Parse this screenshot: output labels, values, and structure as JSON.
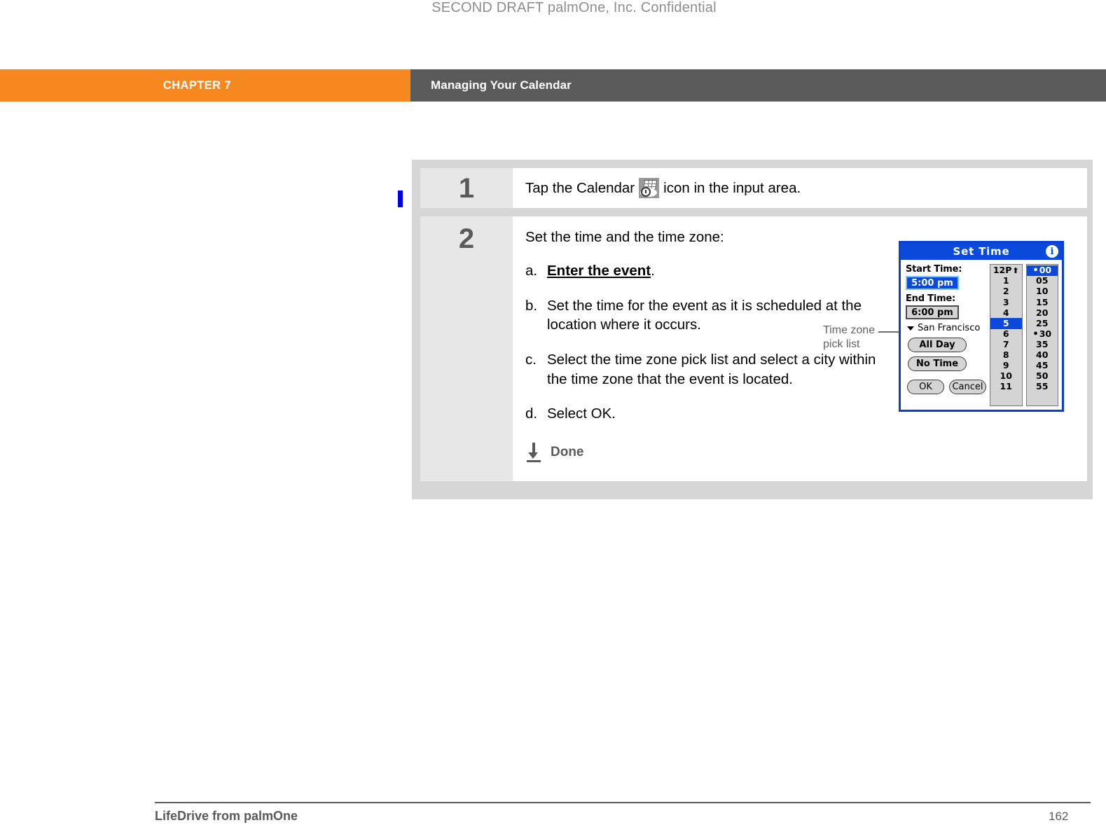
{
  "document": {
    "draft_notice": "SECOND DRAFT palmOne, Inc.  Confidential"
  },
  "header": {
    "chapter_label": "CHAPTER 7",
    "title": "Managing Your Calendar",
    "chapter_bg": "#f6881f",
    "title_bg": "#5a5a5a"
  },
  "steps": [
    {
      "number": "1",
      "text_before_icon": "Tap the Calendar",
      "icon": "calendar-icon",
      "text_after_icon": "icon in the input area."
    },
    {
      "number": "2",
      "lead": "Set the time and the time zone:",
      "substeps": [
        {
          "marker": "a.",
          "text": "Enter the event",
          "emphasis": "bold-underline",
          "suffix": "."
        },
        {
          "marker": "b.",
          "text": "Set the time for the event as it is scheduled at the location where it occurs."
        },
        {
          "marker": "c.",
          "text": "Select the time zone pick list and select a city within the time zone that the event is located."
        },
        {
          "marker": "d.",
          "text": "Select OK."
        }
      ],
      "done_label": "Done",
      "done_icon": "down-arrow-icon"
    }
  ],
  "callout": {
    "line1": "Time zone",
    "line2": "pick list"
  },
  "pda_dialog": {
    "title": "Set Time",
    "info_icon": "info-icon",
    "info_glyph": "i",
    "start_time_label": "Start Time:",
    "start_time_value": "5:00 pm",
    "end_time_label": "End Time:",
    "end_time_value": "6:00 pm",
    "timezone_value": "San Francisco",
    "all_day_label": "All Day",
    "no_time_label": "No Time",
    "ok_label": "OK",
    "cancel_label": "Cancel",
    "hours": [
      "12P",
      "1",
      "2",
      "3",
      "4",
      "5",
      "6",
      "7",
      "8",
      "9",
      "10",
      "11"
    ],
    "hour_selected": "5",
    "hour_first_has_arrow": true,
    "minutes": [
      "00",
      "05",
      "10",
      "15",
      "20",
      "25",
      "30",
      "35",
      "40",
      "45",
      "50",
      "55"
    ],
    "minute_selected": "00",
    "minute_dotted": [
      "00",
      "30"
    ],
    "accent_blue": "#0a49d9",
    "face_gray": "#d4d4d4"
  },
  "footer": {
    "left": "LifeDrive from palmOne",
    "page_number": "162"
  }
}
